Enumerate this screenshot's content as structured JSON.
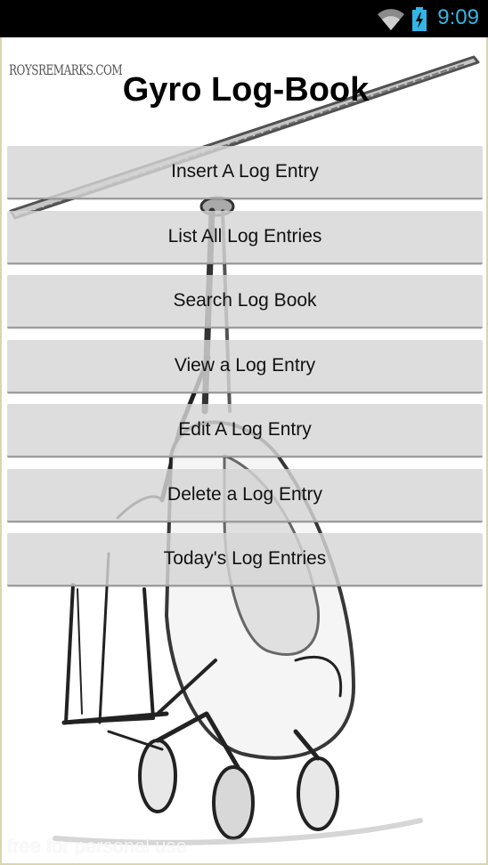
{
  "status_bar": {
    "time": "9:09",
    "icons": [
      "wifi-icon",
      "battery-charging-icon"
    ],
    "accent_color": "#33b5e5"
  },
  "app": {
    "logo_text": "ROYSREMARKS.COM",
    "title": "Gyro Log-Book",
    "background_image": "gyrocopter-sketch",
    "buttons": [
      "Insert A Log Entry",
      "List All Log Entries",
      "Search Log Book",
      "View a Log Entry",
      "Edit A Log Entry",
      "Delete a Log Entry",
      "Today's Log Entries"
    ],
    "footer_watermark": "free for personal use"
  }
}
